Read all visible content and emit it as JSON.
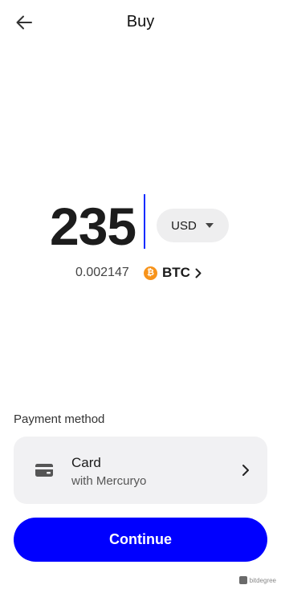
{
  "header": {
    "title": "Buy",
    "back_icon": "arrow-left-icon"
  },
  "amount": {
    "value": "235",
    "currency": "USD",
    "currency_icon": "triangle-down-icon",
    "caret_color": "#0a2bff"
  },
  "conversion": {
    "crypto_amount": "0.002147",
    "crypto_code": "BTC",
    "crypto_icon": "bitcoin-icon",
    "crypto_color": "#f7931a",
    "chevron_icon": "chevron-right-icon"
  },
  "payment": {
    "section_label": "Payment method",
    "method_title": "Card",
    "method_subtitle": "with Mercuryo",
    "method_icon": "credit-card-icon",
    "chevron_icon": "chevron-right-icon"
  },
  "actions": {
    "continue_label": "Continue",
    "continue_color": "#0000ff"
  },
  "watermark": {
    "text": "bitdegree"
  }
}
